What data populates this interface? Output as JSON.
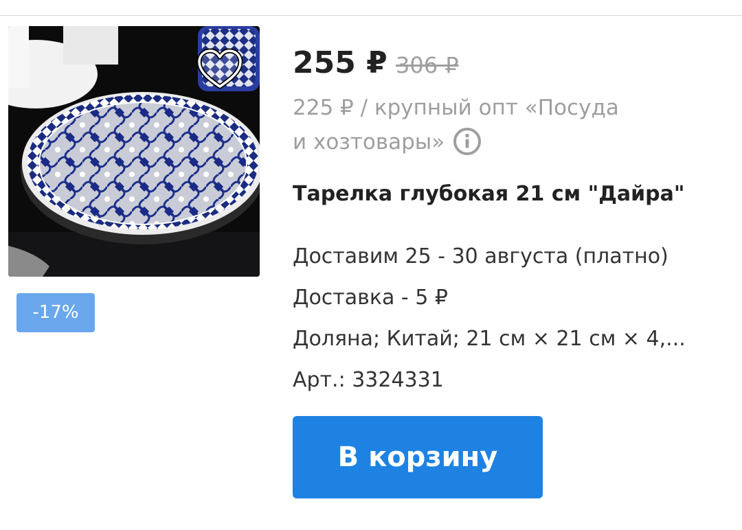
{
  "product": {
    "price": "255 ₽",
    "old_price": "306 ₽",
    "wholesale_line1": "225 ₽ / крупный опт «Посуда",
    "wholesale_line2": "и хозтовары»",
    "discount_badge": "-17%",
    "title": "Тарелка глубокая 21 см \"Дайра\"",
    "delivery_date": "Доставим 25 - 30 августа (платно)",
    "delivery_cost": "Доставка - 5 ₽",
    "specs": "Доляна; Китай; 21 см × 21 см × 4,...",
    "article": "Арт.: 3324331",
    "add_to_cart_label": "В корзину"
  },
  "icons": {
    "favorite": "heart-icon",
    "info": "info-icon"
  },
  "colors": {
    "button": "#1e82e2",
    "badge": "#6aa7ec",
    "price": "#222222",
    "muted": "#9e9e9e"
  }
}
